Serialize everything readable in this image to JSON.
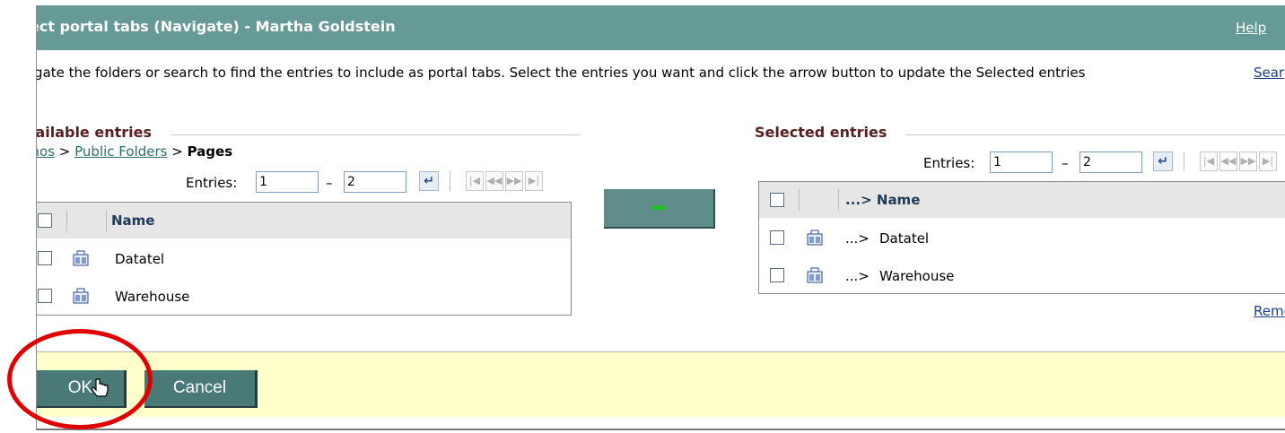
{
  "window": {
    "title": "ect portal tabs (Navigate) - Martha Goldstein",
    "help": "Help"
  },
  "instructions": "vigate the folders or search to find the entries to include as portal tabs. Select the entries you want and click the arrow button to update the Selected entries",
  "search_link": "Sear",
  "available": {
    "title": "vailable entries",
    "breadcrumb": {
      "root": "gnos",
      "sep1": " > ",
      "folder": "Public Folders",
      "sep2": " > ",
      "current": "Pages"
    },
    "entries_label": "Entries:",
    "from": "1",
    "dash": "–",
    "to": "2",
    "column_header": "Name",
    "rows": [
      {
        "label": "Datatel",
        "icon": "page-icon"
      },
      {
        "label": "Warehouse",
        "icon": "page-icon"
      }
    ]
  },
  "add_button": {
    "icon": "arrow-right-icon",
    "glyph": "➡"
  },
  "selected": {
    "title": "Selected entries",
    "entries_label": "Entries:",
    "from": "1",
    "dash": "–",
    "to": "2",
    "column_header": "...> Name",
    "rows": [
      {
        "prefix": "...>",
        "label": "Datatel",
        "icon": "page-icon"
      },
      {
        "prefix": "...>",
        "label": "Warehouse",
        "icon": "page-icon"
      }
    ],
    "remove_link": "Remo"
  },
  "footer": {
    "ok_label": "OK",
    "cancel_label": "Cancel"
  },
  "colors": {
    "titlebar": "#659a96",
    "footer": "#ffffcc",
    "highlight_ring": "#e00000",
    "button": "#4a7a77"
  }
}
